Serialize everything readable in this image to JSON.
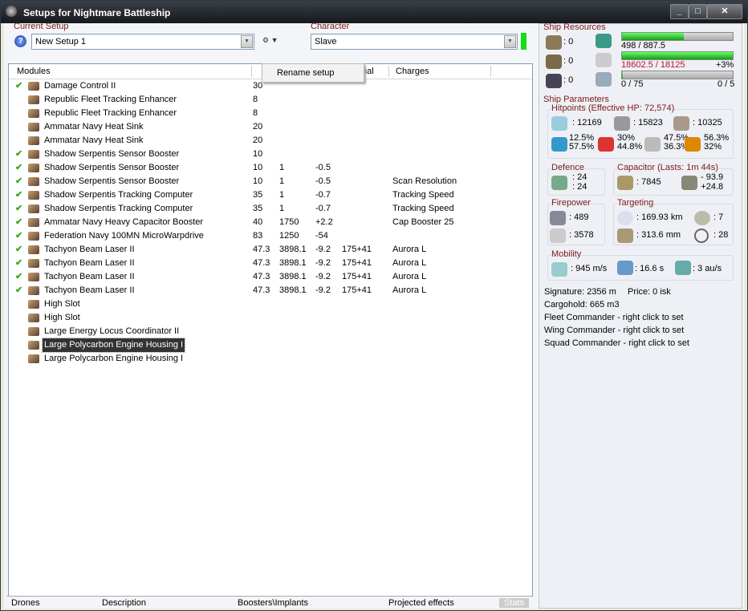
{
  "window": {
    "title": "Setups for Nightmare Battleship",
    "min": "_",
    "max": "□",
    "close": "✕"
  },
  "setup": {
    "label": "Current Setup",
    "value": "New Setup 1",
    "character_label": "Character",
    "character": "Slave"
  },
  "menu": {
    "rename": "Rename setup"
  },
  "list": {
    "headers": [
      "Modules",
      "",
      "",
      "nal",
      "Charges"
    ],
    "rows": [
      {
        "c": true,
        "n": "Damage Control II",
        "a": "30",
        "b": "",
        "d": "",
        "e": "",
        "ch": ""
      },
      {
        "c": false,
        "n": "Republic Fleet Tracking Enhancer",
        "a": "8",
        "b": "",
        "d": "",
        "e": "",
        "ch": ""
      },
      {
        "c": false,
        "n": "Republic Fleet Tracking Enhancer",
        "a": "8",
        "b": "",
        "d": "",
        "e": "",
        "ch": ""
      },
      {
        "c": false,
        "n": "Ammatar Navy Heat Sink",
        "a": "20",
        "b": "",
        "d": "",
        "e": "",
        "ch": ""
      },
      {
        "c": false,
        "n": "Ammatar Navy Heat Sink",
        "a": "20",
        "b": "",
        "d": "",
        "e": "",
        "ch": ""
      },
      {
        "c": true,
        "n": "Shadow Serpentis Sensor Booster",
        "a": "10",
        "b": "",
        "d": "",
        "e": "",
        "ch": ""
      },
      {
        "c": true,
        "n": "Shadow Serpentis Sensor Booster",
        "a": "10",
        "b": "1",
        "d": "-0.5",
        "e": "",
        "ch": ""
      },
      {
        "c": true,
        "n": "Shadow Serpentis Sensor Booster",
        "a": "10",
        "b": "1",
        "d": "-0.5",
        "e": "",
        "ch": "Scan Resolution"
      },
      {
        "c": true,
        "n": "Shadow Serpentis Tracking Computer",
        "a": "35",
        "b": "1",
        "d": "-0.7",
        "e": "",
        "ch": "Tracking Speed"
      },
      {
        "c": true,
        "n": "Shadow Serpentis Tracking Computer",
        "a": "35",
        "b": "1",
        "d": "-0.7",
        "e": "",
        "ch": "Tracking Speed"
      },
      {
        "c": true,
        "n": "Ammatar Navy Heavy Capacitor Booster",
        "a": "40",
        "b": "1750",
        "d": "+2.2",
        "e": "",
        "ch": "Cap Booster 25"
      },
      {
        "c": true,
        "n": "Federation Navy 100MN MicroWarpdrive",
        "a": "83",
        "b": "1250",
        "d": "-54",
        "e": "",
        "ch": ""
      },
      {
        "c": true,
        "n": "Tachyon Beam Laser II",
        "a": "47.3",
        "b": "3898.1",
        "d": "-9.2",
        "e": "175+41",
        "ch": "Aurora L"
      },
      {
        "c": true,
        "n": "Tachyon Beam Laser II",
        "a": "47.3",
        "b": "3898.1",
        "d": "-9.2",
        "e": "175+41",
        "ch": "Aurora L"
      },
      {
        "c": true,
        "n": "Tachyon Beam Laser II",
        "a": "47.3",
        "b": "3898.1",
        "d": "-9.2",
        "e": "175+41",
        "ch": "Aurora L"
      },
      {
        "c": true,
        "n": "Tachyon Beam Laser II",
        "a": "47.3",
        "b": "3898.1",
        "d": "-9.2",
        "e": "175+41",
        "ch": "Aurora L"
      },
      {
        "c": false,
        "n": "High Slot",
        "a": "",
        "b": "",
        "d": "",
        "e": "",
        "ch": ""
      },
      {
        "c": false,
        "n": "High Slot",
        "a": "",
        "b": "",
        "d": "",
        "e": "",
        "ch": ""
      },
      {
        "c": false,
        "n": "Large Energy Locus Coordinator II",
        "a": "",
        "b": "",
        "d": "",
        "e": "",
        "ch": ""
      },
      {
        "c": false,
        "n": "Large Polycarbon Engine Housing I",
        "a": "",
        "b": "",
        "d": "",
        "e": "",
        "ch": "",
        "sel": true
      },
      {
        "c": false,
        "n": "Large Polycarbon Engine Housing I",
        "a": "",
        "b": "",
        "d": "",
        "e": "",
        "ch": ""
      }
    ]
  },
  "tabs": [
    "Drones",
    "Description",
    "Boosters\\Implants",
    "Projected effects",
    "Stats"
  ],
  "resources": {
    "title": "Ship Resources",
    "turrets": ": 0",
    "launchers": ": 0",
    "calibration": ": 0",
    "cpu": "498 / 887.5",
    "cpu_frac": 0.56,
    "power": "18602.5 / 18125",
    "power_pct": "+3%",
    "power_frac": 1.0,
    "drone": "0 / 75",
    "drone_count": "0 / 5",
    "drone_frac": 0.0
  },
  "params": {
    "title": "Ship Parameters",
    "hp_title": "Hitpoints (Effective HP: 72,574)",
    "shield": ": 12169",
    "armor": ": 15823",
    "hull": ": 10325",
    "res": [
      [
        "12.5%",
        "57.5%"
      ],
      [
        "30%",
        "44.8%"
      ],
      [
        "47.5%",
        "36.3%"
      ],
      [
        "56.3%",
        "32%"
      ]
    ],
    "defence_title": "Defence",
    "def1": ": 24",
    "def2": ": 24",
    "cap_title": "Capacitor (Lasts: 1m 44s)",
    "cap": ": 7845",
    "cap_use": "- 93.9",
    "cap_regen": "+24.8",
    "fp_title": "Firepower",
    "dps": ": 489",
    "volley": ": 3578",
    "tgt_title": "Targeting",
    "range": ": 169.93 km",
    "targets": ": 7",
    "scanres": ": 313.6 mm",
    "sensor": ": 28",
    "mob_title": "Mobility",
    "speed": ": 945 m/s",
    "align": ": 16.6 s",
    "warp": ": 3 au/s"
  },
  "info": [
    "Signature: 2356 m",
    "Price: 0 isk",
    "Cargohold: 665 m3",
    "Fleet Commander - right click to set",
    "Wing Commander - right click to set",
    "Squad Commander - right click to set"
  ]
}
